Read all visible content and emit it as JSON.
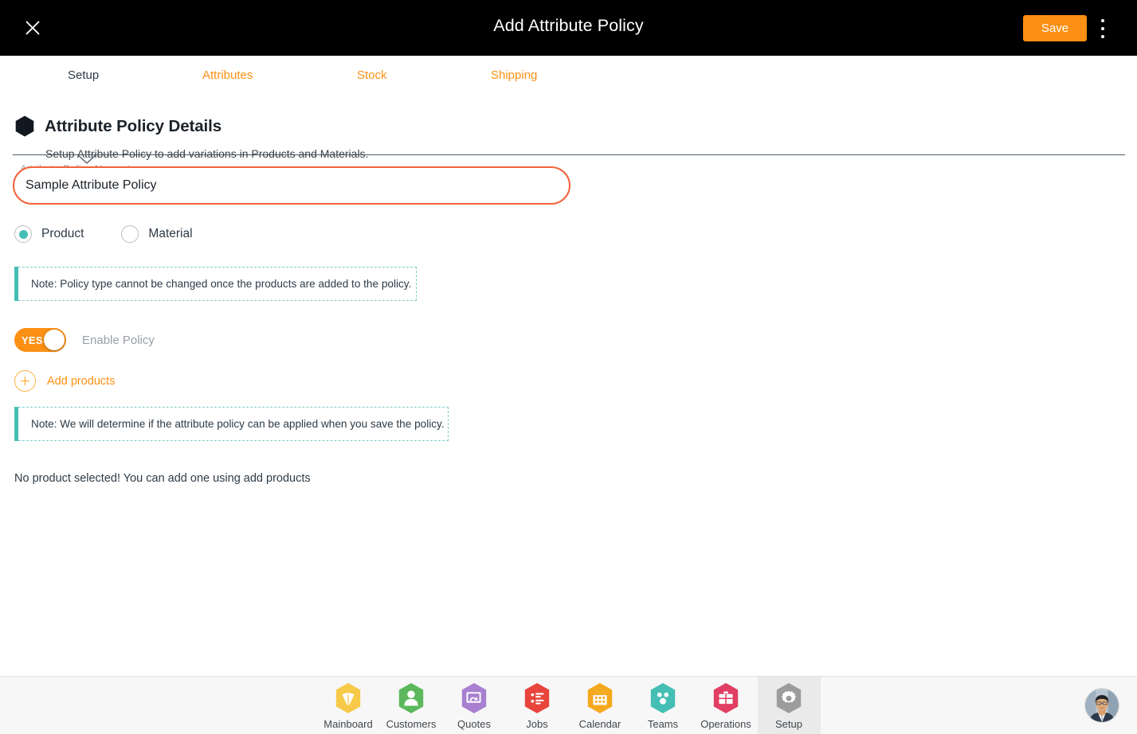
{
  "window": {
    "title": "Add Attribute Policy",
    "close_icon": "close-x-icon",
    "save_label": "Save",
    "menu_icon": "kebab-menu-icon",
    "accent_orange": "#FB9014",
    "accent_teal": "#45BFB5",
    "focus_orange": "#F4623A"
  },
  "tabs": {
    "items": [
      {
        "label": "Setup",
        "active": true
      },
      {
        "label": "Attributes",
        "active": false
      },
      {
        "label": "Stock",
        "active": false
      },
      {
        "label": "Shipping",
        "active": false
      }
    ]
  },
  "section": {
    "bullet_icon": "hexagon-bullet-icon",
    "title": "Attribute Policy Details",
    "subtitle": "Setup Attribute Policy to add variations in Products and Materials."
  },
  "form": {
    "policy_name": {
      "label": "Attribute Policy Name *",
      "value": "Sample Attribute Policy",
      "placeholder": "Attribute Policy Name"
    },
    "policy_type": {
      "options": [
        {
          "label": "Product",
          "selected": true
        },
        {
          "label": "Material",
          "selected": false
        }
      ]
    },
    "note_policy_type": "Note: Policy type cannot be changed once the products are added to the policy.",
    "enable_policy": {
      "toggle_text": "YES",
      "label": "Enable Policy",
      "state": "on"
    },
    "add_products": {
      "icon": "plus-circle-icon",
      "label": "Add products"
    },
    "note_apply": "Note: We will determine if the attribute policy can be applied when you save the policy.",
    "empty_state": "No product selected! You can add one using add products"
  },
  "bottom_nav": {
    "items": [
      {
        "label": "Mainboard",
        "icon": "mainboard-hex-icon",
        "color": "#F7C948",
        "active": false
      },
      {
        "label": "Customers",
        "icon": "customers-hex-icon",
        "color": "#5CB85C",
        "active": false
      },
      {
        "label": "Quotes",
        "icon": "quotes-hex-icon",
        "color": "#A87FD1",
        "active": false
      },
      {
        "label": "Jobs",
        "icon": "jobs-hex-icon",
        "color": "#E8453C",
        "active": false
      },
      {
        "label": "Calendar",
        "icon": "calendar-hex-icon",
        "color": "#F4A81D",
        "active": false
      },
      {
        "label": "Teams",
        "icon": "teams-hex-icon",
        "color": "#45BFB5",
        "active": false
      },
      {
        "label": "Operations",
        "icon": "operations-hex-icon",
        "color": "#E03E62",
        "active": false
      },
      {
        "label": "Setup",
        "icon": "setup-hex-icon",
        "color": "#9C9C9C",
        "active": true
      }
    ],
    "avatar": "user-avatar"
  }
}
